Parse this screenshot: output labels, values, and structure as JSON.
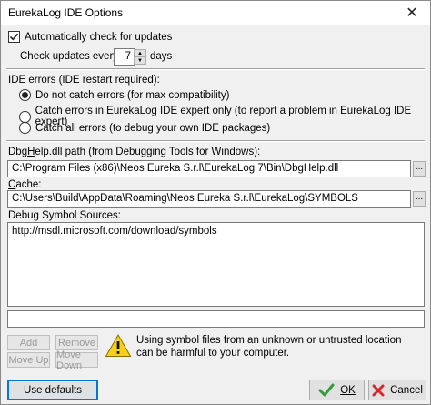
{
  "window": {
    "title": "EurekaLog IDE Options",
    "close_glyph": "✕"
  },
  "updates": {
    "auto_check_label": "Automatically check for updates",
    "auto_check_checked": true,
    "every_label": "Check updates every",
    "days_value": "7",
    "days_unit": "days"
  },
  "ide_errors": {
    "label": "IDE errors (IDE restart required):",
    "options": [
      {
        "label": "Do not catch errors (for max compatibility)",
        "selected": true
      },
      {
        "label": "Catch errors in EurekaLog IDE expert only (to report a problem in EurekaLog IDE expert)",
        "selected": false
      },
      {
        "label": "Catch all errors (to debug your own IDE packages)",
        "selected": false
      }
    ]
  },
  "dbghelp": {
    "label_pre": "Dbg",
    "label_ul": "H",
    "label_post": "elp.dll path (from Debugging Tools for Windows):",
    "value": "C:\\Program Files (x86)\\Neos Eureka S.r.l\\EurekaLog 7\\Bin\\DbgHelp.dll",
    "browse_label": "..."
  },
  "cache": {
    "label_ul": "C",
    "label_post": "ache:",
    "value": "C:\\Users\\Build\\AppData\\Roaming\\Neos Eureka S.r.l\\EurekaLog\\SYMBOLS",
    "browse_label": "..."
  },
  "symbols": {
    "label": "Debug Symbol Sources:",
    "items": [
      "http://msdl.microsoft.com/download/symbols"
    ],
    "new_entry": ""
  },
  "buttons": {
    "add": "Add",
    "remove": "Remove",
    "move_up": "Move Up",
    "move_down": "Move Down",
    "use_defaults": "Use defaults",
    "ok": "OK",
    "cancel": "Cancel"
  },
  "warning": {
    "text": "Using symbol files from an unknown or untrusted location can be harmful to your computer.",
    "icon": "warning-icon"
  },
  "colors": {
    "warning_yellow": "#f7d117",
    "ok_green": "#2e9e3a",
    "cancel_red": "#d42a2a",
    "focus_blue": "#0078d7"
  }
}
